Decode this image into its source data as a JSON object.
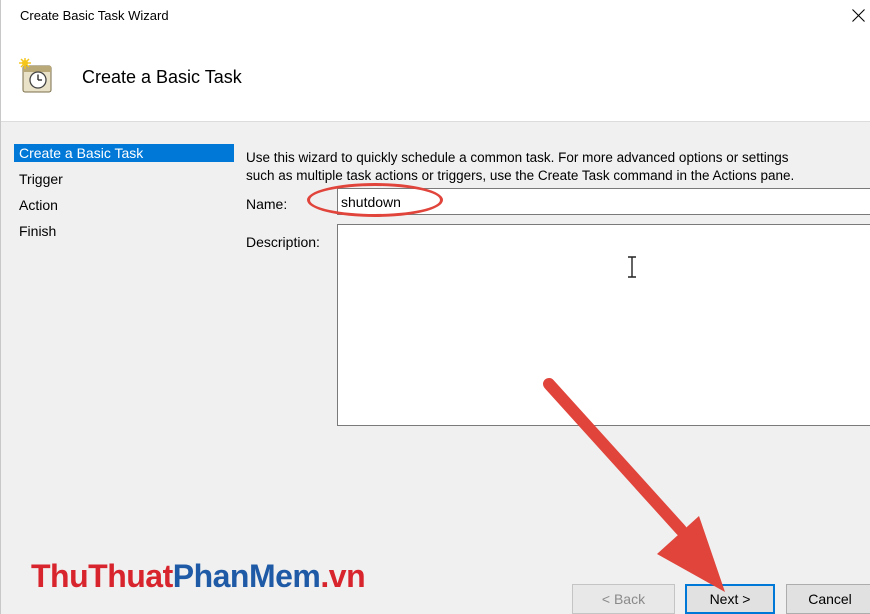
{
  "window": {
    "title": "Create Basic Task Wizard",
    "close_glyph": "✕"
  },
  "header": {
    "title": "Create a Basic Task",
    "icon": "scheduler-clock-icon"
  },
  "nav": {
    "items": [
      {
        "label": "Create a Basic Task",
        "selected": true
      },
      {
        "label": "Trigger",
        "selected": false
      },
      {
        "label": "Action",
        "selected": false
      },
      {
        "label": "Finish",
        "selected": false
      }
    ]
  },
  "form": {
    "intro_line1": "Use this wizard to quickly schedule a common task.  For more advanced options or settings",
    "intro_line2": "such as multiple task actions or triggers, use the Create Task command in the Actions pane.",
    "name_label": "Name:",
    "name_value": "shutdown",
    "description_label": "Description:",
    "description_value": ""
  },
  "buttons": {
    "back": "< Back",
    "next": "Next >",
    "cancel": "Cancel"
  },
  "watermark": {
    "part1": "ThuThuat",
    "part2": "PhanMem",
    "part3": ".vn"
  },
  "colors": {
    "selection": "#0078d7",
    "annotation": "#e0443b",
    "watermark_red": "#d8242c",
    "watermark_blue": "#1f5aa6"
  }
}
